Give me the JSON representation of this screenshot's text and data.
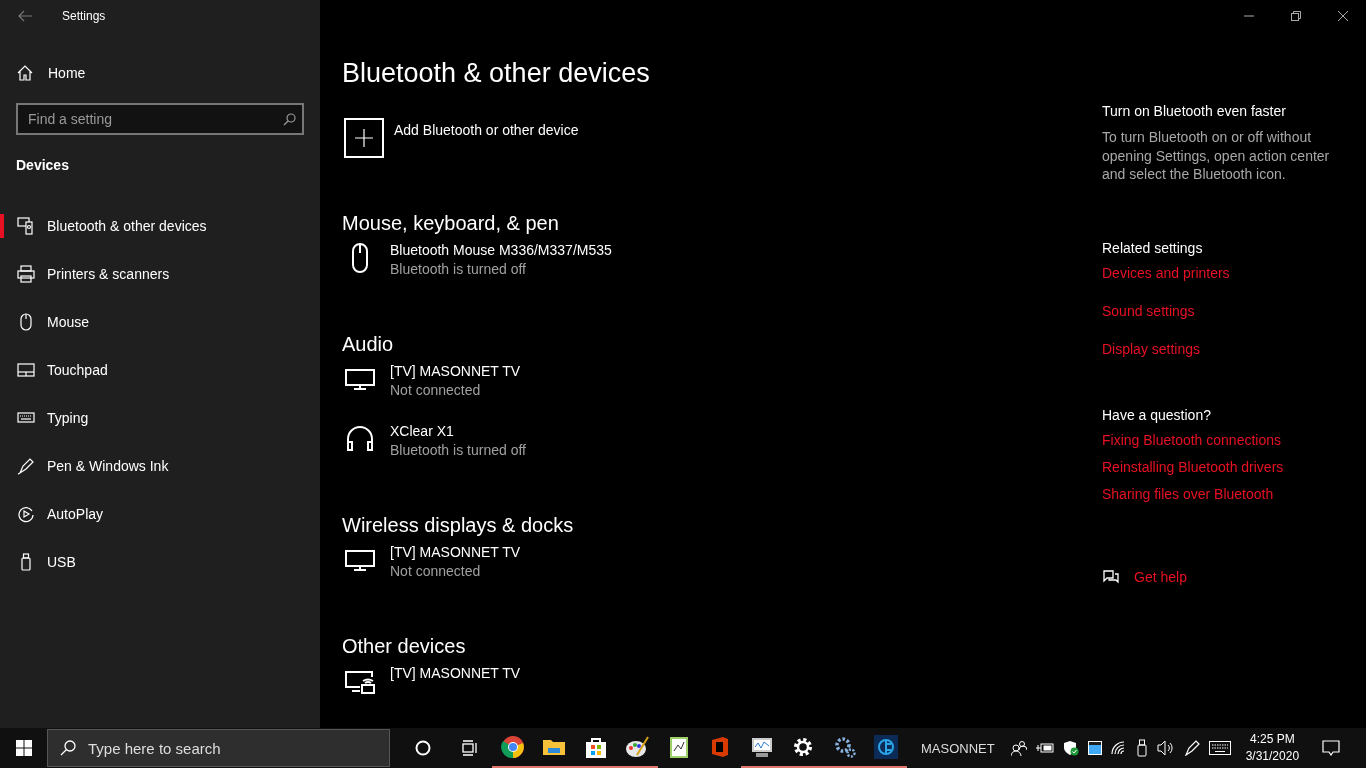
{
  "window": {
    "title": "Settings"
  },
  "sidebar": {
    "home": "Home",
    "search": {
      "placeholder": "Find a setting"
    },
    "section": "Devices",
    "items": [
      {
        "label": "Bluetooth & other devices",
        "kind": "bluetooth",
        "selected": true
      },
      {
        "label": "Printers & scanners",
        "kind": "printer",
        "selected": false
      },
      {
        "label": "Mouse",
        "kind": "mouse",
        "selected": false
      },
      {
        "label": "Touchpad",
        "kind": "touchpad",
        "selected": false
      },
      {
        "label": "Typing",
        "kind": "keyboard",
        "selected": false
      },
      {
        "label": "Pen & Windows Ink",
        "kind": "pen",
        "selected": false
      },
      {
        "label": "AutoPlay",
        "kind": "autoplay",
        "selected": false
      },
      {
        "label": "USB",
        "kind": "usb",
        "selected": false
      }
    ]
  },
  "page": {
    "title": "Bluetooth & other devices",
    "add_button": "Add Bluetooth or other device",
    "groups": [
      {
        "heading": "Mouse, keyboard, & pen",
        "devices": [
          {
            "name": "Bluetooth Mouse M336/M337/M535",
            "status": "Bluetooth is turned off",
            "kind": "mouse"
          }
        ]
      },
      {
        "heading": "Audio",
        "devices": [
          {
            "name": "[TV] MASONNET TV",
            "status": "Not connected",
            "kind": "monitor"
          },
          {
            "name": "XClear X1",
            "status": "Bluetooth is turned off",
            "kind": "headphones"
          }
        ]
      },
      {
        "heading": "Wireless displays & docks",
        "devices": [
          {
            "name": "[TV] MASONNET TV",
            "status": "Not connected",
            "kind": "monitor"
          }
        ]
      },
      {
        "heading": "Other devices",
        "devices": [
          {
            "name": "[TV] MASONNET TV",
            "kind": "wireless-display"
          }
        ]
      }
    ]
  },
  "aside": [
    {
      "heading": "Turn on Bluetooth even faster",
      "text": "To turn Bluetooth on or off without opening Settings, open action center and select the Bluetooth icon."
    },
    {
      "heading": "Related settings",
      "links": [
        "Devices and printers",
        "Sound settings",
        "Display settings"
      ],
      "spaced": true
    },
    {
      "heading": "Have a question?",
      "links": [
        "Fixing Bluetooth connections",
        "Reinstalling Bluetooth drivers",
        "Sharing files over Bluetooth"
      ],
      "spaced": false
    }
  ],
  "help_link": "Get help",
  "taskbar": {
    "search": {
      "placeholder": "Type here to search"
    },
    "apps": [
      {
        "kind": "browser",
        "running": true
      },
      {
        "kind": "folder",
        "running": true
      },
      {
        "kind": "bag",
        "running": true
      },
      {
        "kind": "palette",
        "running": true
      },
      {
        "kind": "notepad",
        "running": false
      },
      {
        "kind": "document",
        "running": false
      },
      {
        "kind": "monitor",
        "running": true
      },
      {
        "kind": "gear",
        "running": true
      },
      {
        "kind": "gears",
        "running": true
      },
      {
        "kind": "square",
        "running": true
      }
    ],
    "user": "MASONNET",
    "time": "4:25 PM",
    "date": "3/31/2020"
  }
}
